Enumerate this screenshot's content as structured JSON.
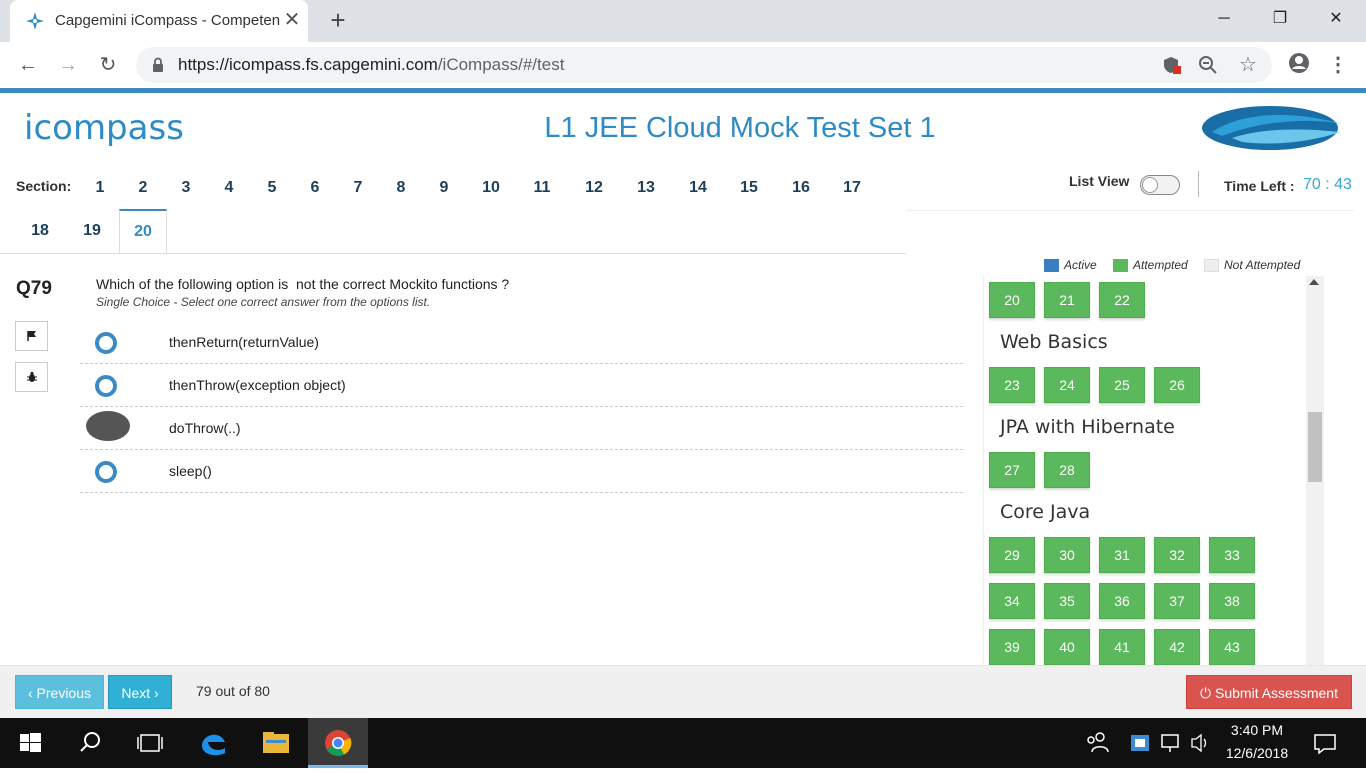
{
  "browser": {
    "tab_title": "Capgemini iCompass - Competency",
    "url_host": "https://icompass.fs.capgemini.com",
    "url_path": "/iCompass/#/test"
  },
  "header": {
    "logo_text": "icompass",
    "title": "L1 JEE Cloud Mock Test Set 1"
  },
  "sections": {
    "label": "Section:",
    "tabs": [
      "1",
      "2",
      "3",
      "4",
      "5",
      "6",
      "7",
      "8",
      "9",
      "10",
      "11",
      "12",
      "13",
      "14",
      "15",
      "16",
      "17",
      "18",
      "19",
      "20"
    ],
    "active": "20"
  },
  "controls": {
    "list_view_label": "List View",
    "list_view_on": false,
    "time_left_label": "Time Left :",
    "time_left_value": "70 : 43"
  },
  "question": {
    "number": "Q79",
    "text": "Which of the following option is  not the correct Mockito functions ?",
    "hint": "Single Choice - Select one correct answer from the options list.",
    "flag_icon": "flag-icon",
    "report_icon": "bug-icon",
    "options": [
      {
        "label": "thenReturn(returnValue)",
        "selected": false
      },
      {
        "label": "thenThrow(exception object)",
        "selected": false
      },
      {
        "label": "doThrow(..)",
        "selected": true
      },
      {
        "label": "sleep()",
        "selected": false
      }
    ]
  },
  "legend": {
    "active": "Active",
    "attempted": "Attempted",
    "not_attempted": "Not Attempted",
    "active_color": "#3a7ec2",
    "attempted_color": "#5cb85c",
    "not_attempted_color": "#eeeeee"
  },
  "palette": {
    "row0": [
      "20",
      "21",
      "22"
    ],
    "group1_title": "Web Basics",
    "group1": [
      "23",
      "24",
      "25",
      "26"
    ],
    "group2_title": "JPA with Hibernate",
    "group2": [
      "27",
      "28"
    ],
    "group3_title": "Core Java",
    "group3_row1": [
      "29",
      "30",
      "31",
      "32",
      "33"
    ],
    "group3_row2": [
      "34",
      "35",
      "36",
      "37",
      "38"
    ],
    "group3_row3": [
      "39",
      "40",
      "41",
      "42",
      "43"
    ]
  },
  "footer": {
    "previous_label": "‹ Previous",
    "next_label": "Next ›",
    "progress": "79 out of 80",
    "submit_label": "Submit Assessment"
  },
  "taskbar": {
    "time": "3:40 PM",
    "date": "12/6/2018"
  }
}
